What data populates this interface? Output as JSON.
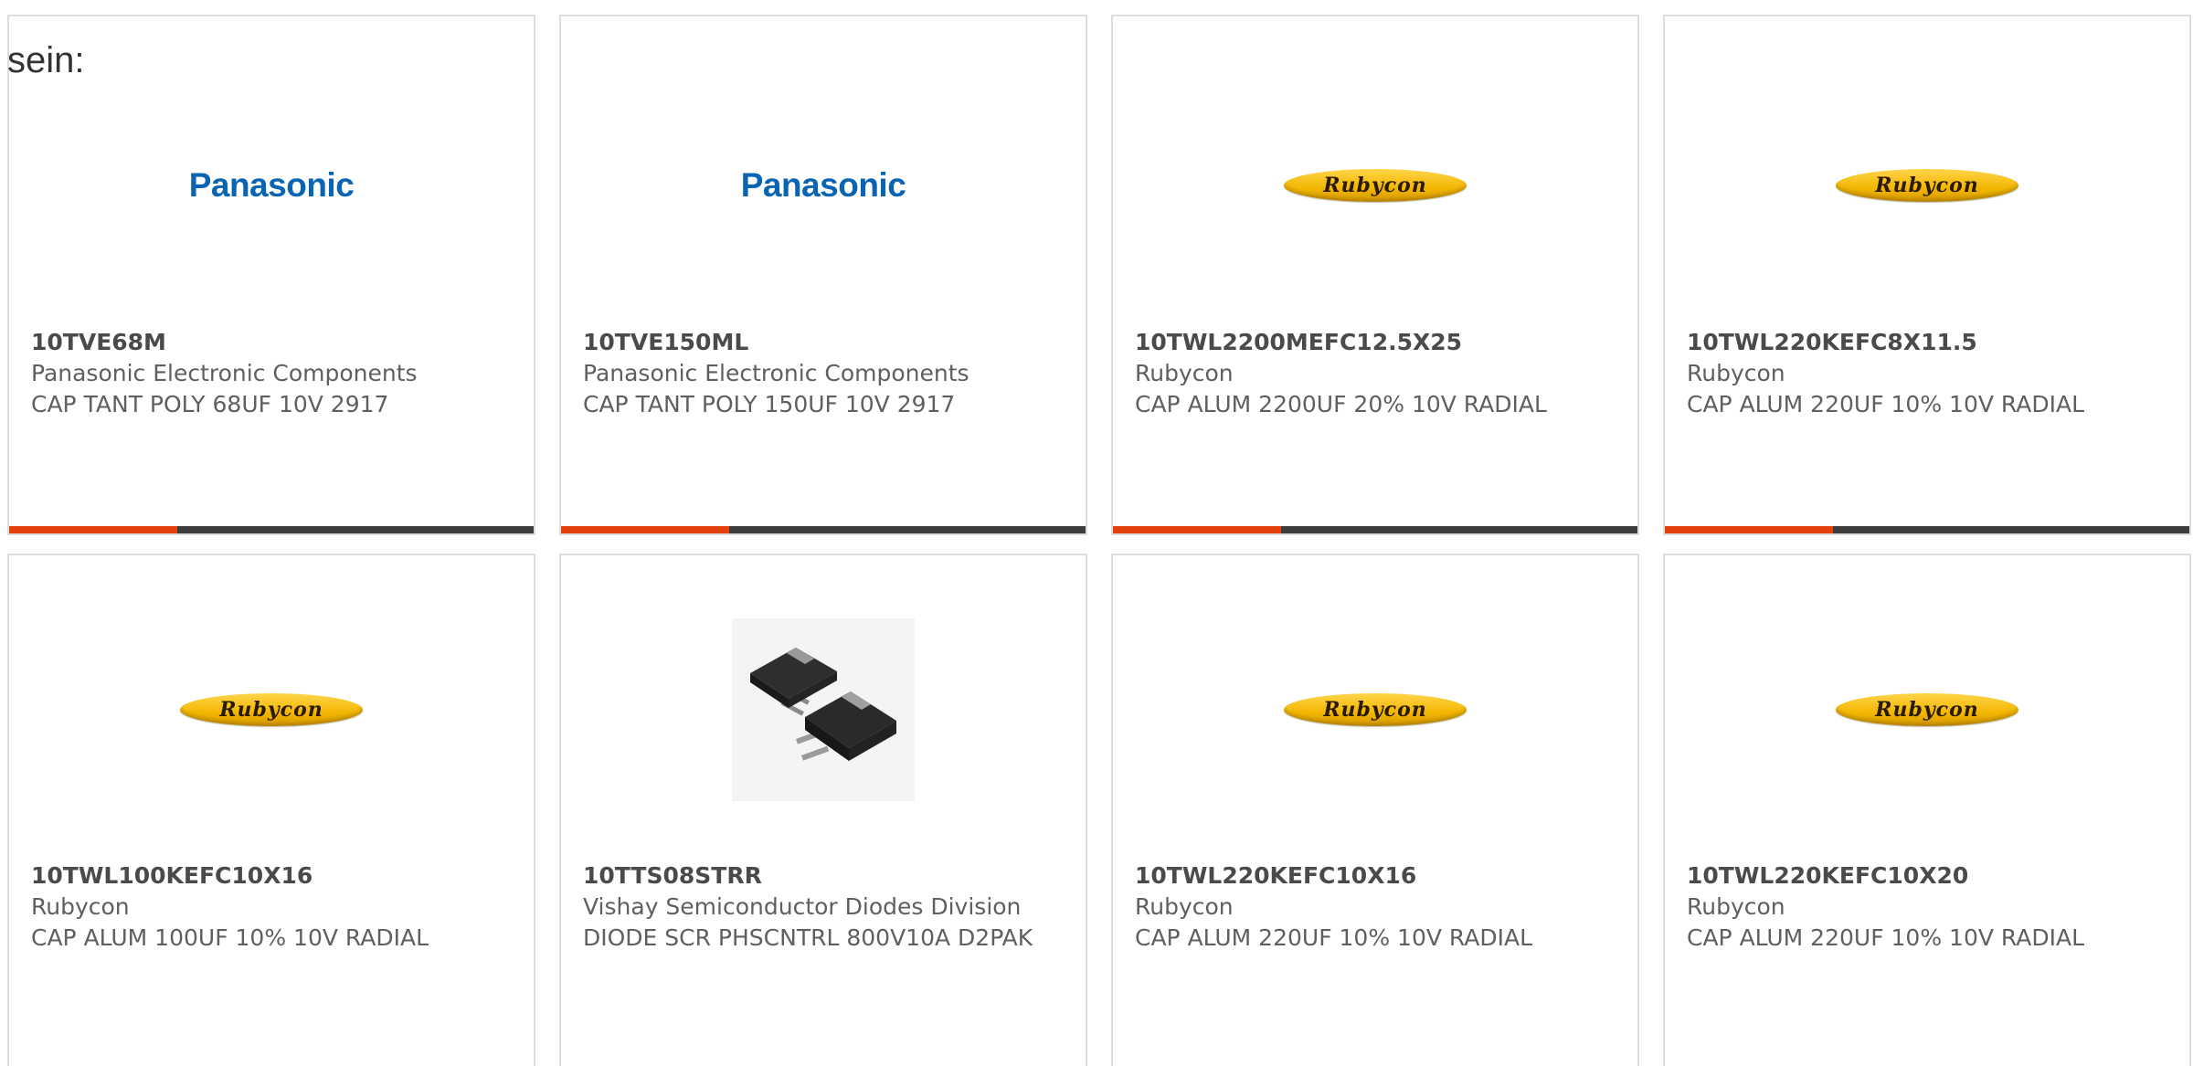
{
  "intro_text": "sein:",
  "accent_color": "#e0410d",
  "cards": [
    {
      "logo": "panasonic-logo",
      "logo_text": "Panasonic",
      "part_number": "10TVE68M",
      "manufacturer": "Panasonic Electronic Components",
      "description": "CAP TANT POLY 68UF 10V 2917",
      "progress": 0.32
    },
    {
      "logo": "panasonic-logo",
      "logo_text": "Panasonic",
      "part_number": "10TVE150ML",
      "manufacturer": "Panasonic Electronic Components",
      "description": "CAP TANT POLY 150UF 10V 2917",
      "progress": 0.32
    },
    {
      "logo": "rubycon-logo",
      "logo_text": "Rubycon",
      "part_number": "10TWL2200MEFC12.5X25",
      "manufacturer": "Rubycon",
      "description": "CAP ALUM 2200UF 20% 10V RADIAL",
      "progress": 0.32
    },
    {
      "logo": "rubycon-logo",
      "logo_text": "Rubycon",
      "part_number": "10TWL220KEFC8X11.5",
      "manufacturer": "Rubycon",
      "description": "CAP ALUM 220UF 10% 10V RADIAL",
      "progress": 0.32
    },
    {
      "logo": "rubycon-logo",
      "logo_text": "Rubycon",
      "part_number": "10TWL100KEFC10X16",
      "manufacturer": "Rubycon",
      "description": "CAP ALUM 100UF 10% 10V RADIAL"
    },
    {
      "logo": "d2pak-product-image",
      "part_number": "10TTS08STRR",
      "manufacturer": "Vishay Semiconductor Diodes Division",
      "description": "DIODE SCR PHSCNTRL 800V10A D2PAK"
    },
    {
      "logo": "rubycon-logo",
      "logo_text": "Rubycon",
      "part_number": "10TWL220KEFC10X16",
      "manufacturer": "Rubycon",
      "description": "CAP ALUM 220UF 10% 10V RADIAL"
    },
    {
      "logo": "rubycon-logo",
      "logo_text": "Rubycon",
      "part_number": "10TWL220KEFC10X20",
      "manufacturer": "Rubycon",
      "description": "CAP ALUM 220UF 10% 10V RADIAL"
    }
  ]
}
